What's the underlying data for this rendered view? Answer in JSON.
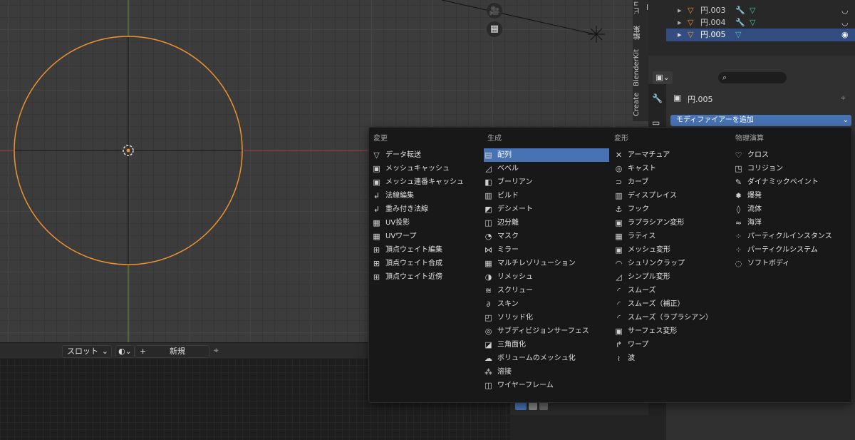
{
  "sidebar_tabs": [
    "ビュー",
    "編集",
    "BlenderKit",
    "Create"
  ],
  "outliner": {
    "rows": [
      {
        "label": "円.003",
        "active": false
      },
      {
        "label": "円.004",
        "active": false
      },
      {
        "label": "円.005",
        "active": true
      }
    ]
  },
  "properties": {
    "object_name": "円.005",
    "add_modifier_label": "モディファイアーを追加",
    "search_placeholder": ""
  },
  "header": {
    "slot_label": "スロット",
    "new_label": "新規",
    "plus": "+"
  },
  "menu": {
    "columns": [
      {
        "title": "変更",
        "items": [
          {
            "label": "データ転送",
            "icon": "▽"
          },
          {
            "label": "メッシュキャッシュ",
            "icon": "▣"
          },
          {
            "label": "メッシュ連番キャッシュ",
            "icon": "▣"
          },
          {
            "label": "法線編集",
            "icon": "↲"
          },
          {
            "label": "重み付き法線",
            "icon": "↲"
          },
          {
            "label": "UV投影",
            "icon": "▦"
          },
          {
            "label": "UVワープ",
            "icon": "▦"
          },
          {
            "label": "頂点ウェイト編集",
            "icon": "⊞"
          },
          {
            "label": "頂点ウェイト合成",
            "icon": "⊞"
          },
          {
            "label": "頂点ウェイト近傍",
            "icon": "⊞"
          }
        ]
      },
      {
        "title": "生成",
        "items": [
          {
            "label": "配列",
            "icon": "▤",
            "highlighted": true
          },
          {
            "label": "ベベル",
            "icon": "◿"
          },
          {
            "label": "ブーリアン",
            "icon": "◧"
          },
          {
            "label": "ビルド",
            "icon": "▥"
          },
          {
            "label": "デシメート",
            "icon": "◩"
          },
          {
            "label": "辺分離",
            "icon": "◫"
          },
          {
            "label": "マスク",
            "icon": "◔"
          },
          {
            "label": "ミラー",
            "icon": "⋈"
          },
          {
            "label": "マルチレゾリューション",
            "icon": "▦"
          },
          {
            "label": "リメッシュ",
            "icon": "◑"
          },
          {
            "label": "スクリュー",
            "icon": "≋"
          },
          {
            "label": "スキン",
            "icon": "∂"
          },
          {
            "label": "ソリッド化",
            "icon": "◰"
          },
          {
            "label": "サブディビジョンサーフェス",
            "icon": "◎"
          },
          {
            "label": "三角面化",
            "icon": "◪"
          },
          {
            "label": "ボリュームのメッシュ化",
            "icon": "☁"
          },
          {
            "label": "溶接",
            "icon": "⁂"
          },
          {
            "label": "ワイヤーフレーム",
            "icon": "◫"
          }
        ]
      },
      {
        "title": "変形",
        "items": [
          {
            "label": "アーマチュア",
            "icon": "✕"
          },
          {
            "label": "キャスト",
            "icon": "◎"
          },
          {
            "label": "カーブ",
            "icon": "⊃"
          },
          {
            "label": "ディスプレイス",
            "icon": "▥"
          },
          {
            "label": "フック",
            "icon": "⚓"
          },
          {
            "label": "ラプラシアン変形",
            "icon": "▣"
          },
          {
            "label": "ラティス",
            "icon": "▦"
          },
          {
            "label": "メッシュ変形",
            "icon": "▣"
          },
          {
            "label": "シュリンクラップ",
            "icon": "◠"
          },
          {
            "label": "シンプル変形",
            "icon": "◿"
          },
          {
            "label": "スムーズ",
            "icon": "◜"
          },
          {
            "label": "スムーズ（補正）",
            "icon": "◜"
          },
          {
            "label": "スムーズ（ラプラシアン）",
            "icon": "◜"
          },
          {
            "label": "サーフェス変形",
            "icon": "▣"
          },
          {
            "label": "ワープ",
            "icon": "↱"
          },
          {
            "label": "波",
            "icon": "≀"
          }
        ]
      },
      {
        "title": "物理演算",
        "items": [
          {
            "label": "クロス",
            "icon": "♡"
          },
          {
            "label": "コリジョン",
            "icon": "◳"
          },
          {
            "label": "ダイナミックペイント",
            "icon": "✎"
          },
          {
            "label": "爆発",
            "icon": "✹"
          },
          {
            "label": "流体",
            "icon": "◊"
          },
          {
            "label": "海洋",
            "icon": "≈"
          },
          {
            "label": "パーティクルインスタンス",
            "icon": "⁘"
          },
          {
            "label": "パーティクルシステム",
            "icon": "⁘"
          },
          {
            "label": "ソフトボディ",
            "icon": "◌"
          }
        ]
      }
    ]
  },
  "colors": {
    "selection_orange": "#f0922e",
    "highlight_blue": "#4772b3",
    "active_row": "#334d80"
  }
}
